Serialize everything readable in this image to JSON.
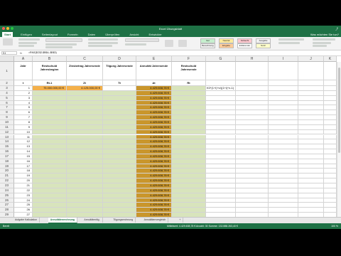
{
  "window": {
    "title": "Excel Übungsblatt"
  },
  "ribbon": {
    "tabs": [
      "Start",
      "Einfügen",
      "Seitenlayout",
      "Formeln",
      "Daten",
      "Überprüfen",
      "Ansicht",
      "Entwickler"
    ],
    "right_label": "Was möchten Sie tun?",
    "styles": [
      {
        "label": "Gut",
        "color": "#c6efce"
      },
      {
        "label": "Neutral",
        "color": "#ffeb9c"
      },
      {
        "label": "Schlecht",
        "color": "#ffc7ce"
      },
      {
        "label": "Ausgabe",
        "color": "#f2f2f2"
      },
      {
        "label": "Berechnung",
        "color": "#f2f2f2"
      },
      {
        "label": "Eingabe",
        "color": "#ffcc99"
      },
      {
        "label": "Erklärender",
        "color": "#ffffff"
      },
      {
        "label": "Notiz",
        "color": "#ffffcc"
      }
    ]
  },
  "formula_bar": {
    "name_box": "E4",
    "fx": "fx",
    "formula": "=RMZ($C$2;$B$4;-$B$3)"
  },
  "columns": [
    "A",
    "B",
    "C",
    "D",
    "E",
    "F",
    "G",
    "H",
    "I",
    "J",
    "K",
    "L"
  ],
  "table": {
    "headers": [
      {
        "col": "A",
        "text": "Jahr"
      },
      {
        "col": "B",
        "text": "Restschuld Jahresbeginn"
      },
      {
        "col": "C",
        "text": "Zinsbetrag Jahresende"
      },
      {
        "col": "D",
        "text": "Tilgung Jahresende"
      },
      {
        "col": "E",
        "text": "Annuität Jahresende"
      },
      {
        "col": "F",
        "text": "Restschuld Jahresende"
      }
    ],
    "symbols": [
      "t",
      "Rt-1",
      "Zt",
      "Tt",
      "At",
      "Rt"
    ],
    "row3": {
      "year": "1",
      "restschuld": "75.000.000,00 €",
      "zins": "4.125.000,00 €",
      "annuitaet": "4.429.608,78 €",
      "note": "K0*(1+i)^n/((1+i)^n-1)"
    },
    "years": [
      "1",
      "2",
      "3",
      "4",
      "5",
      "6",
      "7",
      "8",
      "9",
      "10",
      "11",
      "12",
      "13",
      "14",
      "15",
      "16",
      "17",
      "18",
      "19",
      "20",
      "21",
      "22",
      "23",
      "24",
      "25",
      "26",
      "27",
      "28",
      "29",
      "30"
    ],
    "annuity_value": "4.429.608,78 €"
  },
  "sheet_tabs": [
    "Aufgabe Kalkulation",
    "Annuitätenrechnung",
    "Annuitätentilg.",
    "Tilgungsrechnung",
    "Annuitätenvergleich"
  ],
  "active_tab_index": 1,
  "status": {
    "left": "Bereit",
    "center": "Mittelwert: 4.429.608,78 €   Anzahl: 30   Summe: 132.888.263,40 €",
    "zoom": "100 %"
  }
}
